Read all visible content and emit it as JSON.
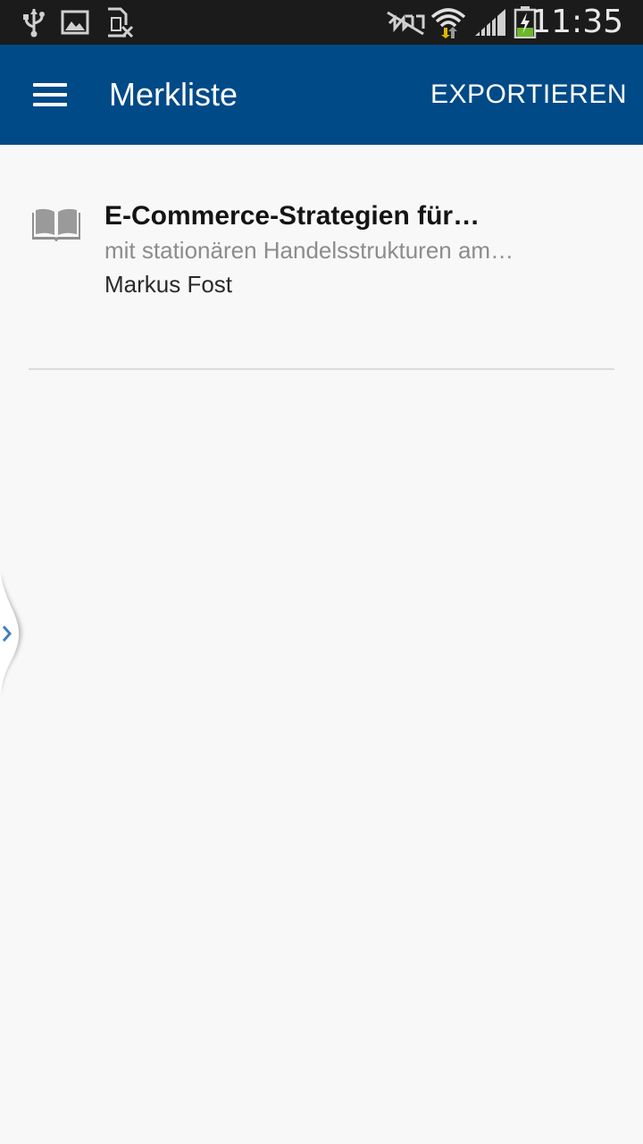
{
  "status_bar": {
    "time": "11:35",
    "icons": [
      "usb-icon",
      "image-notification-icon",
      "no-sim-icon",
      "nfc-off-icon",
      "wifi-icon",
      "signal-icon",
      "battery-charging-icon"
    ]
  },
  "app_bar": {
    "menu_icon": "hamburger-menu-icon",
    "title": "Merkliste",
    "action_label": "EXPORTIEREN",
    "color": "#004a87"
  },
  "bookmarks": [
    {
      "icon": "book-icon",
      "title": "E-Commerce-Strategien für…",
      "subtitle": "mit stationären Handelsstrukturen am…",
      "author": "Markus Fost"
    }
  ],
  "side_handle": {
    "icon": "chevron-right-icon"
  }
}
